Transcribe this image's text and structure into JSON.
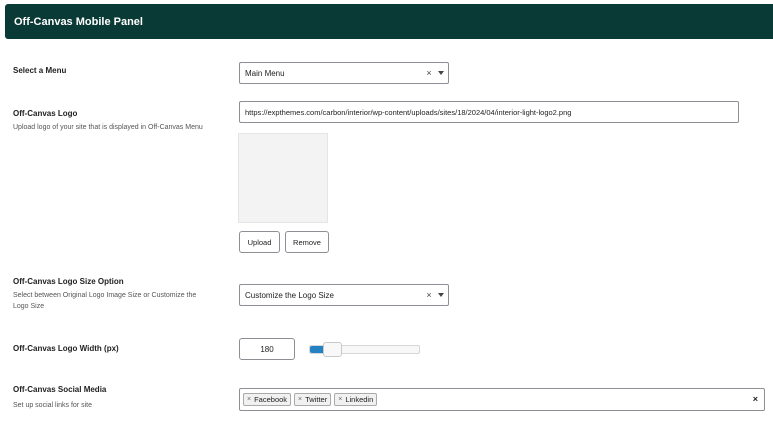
{
  "header": {
    "title": "Off-Canvas Mobile Panel"
  },
  "menu": {
    "label": "Select a Menu",
    "selected": "Main Menu",
    "clear_symbol": "×"
  },
  "logo": {
    "label": "Off-Canvas Logo",
    "description": "Upload logo of your site that is displayed in Off-Canvas Menu",
    "url": "https://expthemes.com/carbon/interior/wp-content/uploads/sites/18/2024/04/interior-light-logo2.png",
    "upload_label": "Upload",
    "remove_label": "Remove"
  },
  "logo_size": {
    "label": "Off-Canvas Logo Size Option",
    "description": "Select between Original Logo Image Size or Customize the Logo Size",
    "selected": "Customize the Logo Size",
    "clear_symbol": "×"
  },
  "logo_width": {
    "label": "Off-Canvas Logo Width (px)",
    "value": "180",
    "slider_fraction": 0.18
  },
  "social": {
    "label": "Off-Canvas Social Media",
    "description": "Set up social links for site",
    "tags": [
      {
        "remove": "×",
        "label": "Facebook"
      },
      {
        "remove": "×",
        "label": "Twitter"
      },
      {
        "remove": "×",
        "label": "Linkedin"
      }
    ],
    "clear_all": "×"
  },
  "colors": {
    "header_bg": "#0a3a36",
    "slider_accent": "#2481c4"
  }
}
